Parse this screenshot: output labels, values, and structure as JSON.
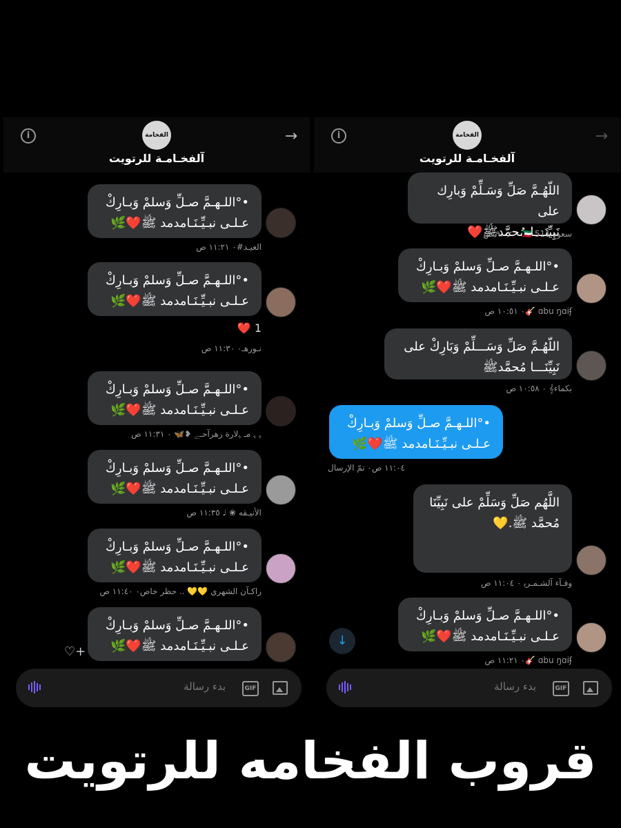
{
  "header": {
    "group_title": "آلفخـامـة للرتويت",
    "logo_text": "الفخامة",
    "back_icon": "arrow-right-icon",
    "info_icon": "info-icon"
  },
  "composer": {
    "placeholder": "بدء رسالة",
    "gif_label": "GIF"
  },
  "left_panel": {
    "messages": [
      {
        "text": "•°اللـهـمَّ صـلِّ وَسلمْ وَبـارِكْ\nعـلـى نبـيِّـنَـامدمد ﷺ❤️🌿",
        "meta": "الغيـد#٠ ١١:٢١ ص",
        "reaction": ""
      },
      {
        "text": "•°اللـهـمَّ صـلِّ وَسلمْ وَبـارِكْ\nعـلـى نبـيِّـنَـامدمد ﷺ❤️🌿",
        "meta": "نـورهـ٠ ١١:٣٠ ص",
        "reaction": "❤️ 1"
      },
      {
        "text": "•°اللـهـمَّ صـلِّ وَسلمْ وَبـارِكْ\nعـلـى نبـيِّـنَـامدمد ﷺ❤️🌿",
        "meta": "ﮩ ﮩ مـ ﮩلارة زهرآحـﮯ ❥🦋 ٠ ١١:٣١ ص",
        "reaction": ""
      },
      {
        "text": "•°اللـهـمَّ صـلِّ وَسلمْ وَبـارِكْ\nعـلـى نبـيِّـنَـامدمد ﷺ❤️🌿",
        "meta": "الأنيـقه ❀ ♩ ١١:٣٥ ص",
        "reaction": ""
      },
      {
        "text": "•°اللـهـمَّ صـلِّ وَسلمْ وَبـارِكْ\nعـلـى نبـيِّـنَـامدمد ﷺ❤️🌿",
        "meta": "راكـآن الشهري 💛💛 .. حظر خاص٠ ١١:٤٠ ص",
        "reaction": ""
      },
      {
        "text": "•°اللـهـمَّ صـلِّ وَسلمْ وَبـارِكْ\nعـلـى نبـيِّـنَـامدمد ﷺ❤️🌿",
        "meta": "",
        "reaction": ""
      }
    ]
  },
  "right_panel": {
    "messages": [
      {
        "text": "اللّهُـمَّ صَلِّ وَسَـلِّمْ وَبارِك على\nنَبِيِّنَـــا مُحمَّدﷺ❤️",
        "meta": "سعود 511 🇰🇼 ٠ ٩:٠٢ ص",
        "sent": false
      },
      {
        "text": "•°اللـهـمَّ صـلِّ وَسلمْ وَبـارِكْ\nعـلـى نبـيِّـنَـامدمد ﷺ❤️🌿",
        "meta": "ɑbu ŋɑiʄ 🎸٠ ١٠:٥١ ص",
        "sent": false
      },
      {
        "text": "اللّهُـمَّ صَلِّ وَسَـــلِّمْ وَبَارِكْ على\nنَبِيِّنَـــا مُحمَّدﷺ",
        "meta": "بكماء𝄞 ٠ ١٠:٥٨ ص",
        "sent": false
      },
      {
        "text": "•°اللـهـمَّ صـلِّ وَسلمْ وَبـارِكْ\nعـلـى نبـيِّـنَـامدمد ﷺ❤️🌿",
        "meta": "١١:٠٤ ص٠ تمّ الإرسال",
        "sent": true
      },
      {
        "text": "اللَّهُم صَلِّ وَسَلِّمْ على نَبِيِّنَا\nمُحمَّد ﷺ.💛",
        "meta": "وفـآء آلشـمـرﯾ ٠ ١١:٠٤ ص",
        "sent": false
      },
      {
        "text": "•°اللـهـمَّ صـلِّ وَسلمْ وَبـارِكْ\nعـلـى نبـيِّـنَـامدمد ﷺ❤️🌿",
        "meta": "ɑbu ŋɑiʄ 🎸٠ ١١:٢١ ص",
        "sent": false
      }
    ]
  },
  "footer": {
    "title": "قروب الفخامه للرتويت"
  },
  "colors": {
    "bubble": "#333436",
    "sent_bubble": "#1d9bf0",
    "background": "#000000",
    "accent_audio": "#7a5cff"
  }
}
